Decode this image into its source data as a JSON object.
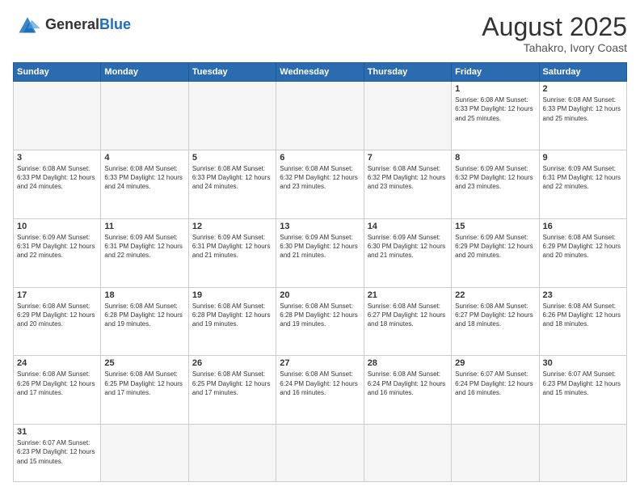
{
  "header": {
    "logo_general": "General",
    "logo_blue": "Blue",
    "month_title": "August 2025",
    "location": "Tahakro, Ivory Coast"
  },
  "weekdays": [
    "Sunday",
    "Monday",
    "Tuesday",
    "Wednesday",
    "Thursday",
    "Friday",
    "Saturday"
  ],
  "weeks": [
    [
      {
        "day": "",
        "info": ""
      },
      {
        "day": "",
        "info": ""
      },
      {
        "day": "",
        "info": ""
      },
      {
        "day": "",
        "info": ""
      },
      {
        "day": "",
        "info": ""
      },
      {
        "day": "1",
        "info": "Sunrise: 6:08 AM\nSunset: 6:33 PM\nDaylight: 12 hours\nand 25 minutes."
      },
      {
        "day": "2",
        "info": "Sunrise: 6:08 AM\nSunset: 6:33 PM\nDaylight: 12 hours\nand 25 minutes."
      }
    ],
    [
      {
        "day": "3",
        "info": "Sunrise: 6:08 AM\nSunset: 6:33 PM\nDaylight: 12 hours\nand 24 minutes."
      },
      {
        "day": "4",
        "info": "Sunrise: 6:08 AM\nSunset: 6:33 PM\nDaylight: 12 hours\nand 24 minutes."
      },
      {
        "day": "5",
        "info": "Sunrise: 6:08 AM\nSunset: 6:33 PM\nDaylight: 12 hours\nand 24 minutes."
      },
      {
        "day": "6",
        "info": "Sunrise: 6:08 AM\nSunset: 6:32 PM\nDaylight: 12 hours\nand 23 minutes."
      },
      {
        "day": "7",
        "info": "Sunrise: 6:08 AM\nSunset: 6:32 PM\nDaylight: 12 hours\nand 23 minutes."
      },
      {
        "day": "8",
        "info": "Sunrise: 6:09 AM\nSunset: 6:32 PM\nDaylight: 12 hours\nand 23 minutes."
      },
      {
        "day": "9",
        "info": "Sunrise: 6:09 AM\nSunset: 6:31 PM\nDaylight: 12 hours\nand 22 minutes."
      }
    ],
    [
      {
        "day": "10",
        "info": "Sunrise: 6:09 AM\nSunset: 6:31 PM\nDaylight: 12 hours\nand 22 minutes."
      },
      {
        "day": "11",
        "info": "Sunrise: 6:09 AM\nSunset: 6:31 PM\nDaylight: 12 hours\nand 22 minutes."
      },
      {
        "day": "12",
        "info": "Sunrise: 6:09 AM\nSunset: 6:31 PM\nDaylight: 12 hours\nand 21 minutes."
      },
      {
        "day": "13",
        "info": "Sunrise: 6:09 AM\nSunset: 6:30 PM\nDaylight: 12 hours\nand 21 minutes."
      },
      {
        "day": "14",
        "info": "Sunrise: 6:09 AM\nSunset: 6:30 PM\nDaylight: 12 hours\nand 21 minutes."
      },
      {
        "day": "15",
        "info": "Sunrise: 6:09 AM\nSunset: 6:29 PM\nDaylight: 12 hours\nand 20 minutes."
      },
      {
        "day": "16",
        "info": "Sunrise: 6:08 AM\nSunset: 6:29 PM\nDaylight: 12 hours\nand 20 minutes."
      }
    ],
    [
      {
        "day": "17",
        "info": "Sunrise: 6:08 AM\nSunset: 6:29 PM\nDaylight: 12 hours\nand 20 minutes."
      },
      {
        "day": "18",
        "info": "Sunrise: 6:08 AM\nSunset: 6:28 PM\nDaylight: 12 hours\nand 19 minutes."
      },
      {
        "day": "19",
        "info": "Sunrise: 6:08 AM\nSunset: 6:28 PM\nDaylight: 12 hours\nand 19 minutes."
      },
      {
        "day": "20",
        "info": "Sunrise: 6:08 AM\nSunset: 6:28 PM\nDaylight: 12 hours\nand 19 minutes."
      },
      {
        "day": "21",
        "info": "Sunrise: 6:08 AM\nSunset: 6:27 PM\nDaylight: 12 hours\nand 18 minutes."
      },
      {
        "day": "22",
        "info": "Sunrise: 6:08 AM\nSunset: 6:27 PM\nDaylight: 12 hours\nand 18 minutes."
      },
      {
        "day": "23",
        "info": "Sunrise: 6:08 AM\nSunset: 6:26 PM\nDaylight: 12 hours\nand 18 minutes."
      }
    ],
    [
      {
        "day": "24",
        "info": "Sunrise: 6:08 AM\nSunset: 6:26 PM\nDaylight: 12 hours\nand 17 minutes."
      },
      {
        "day": "25",
        "info": "Sunrise: 6:08 AM\nSunset: 6:25 PM\nDaylight: 12 hours\nand 17 minutes."
      },
      {
        "day": "26",
        "info": "Sunrise: 6:08 AM\nSunset: 6:25 PM\nDaylight: 12 hours\nand 17 minutes."
      },
      {
        "day": "27",
        "info": "Sunrise: 6:08 AM\nSunset: 6:24 PM\nDaylight: 12 hours\nand 16 minutes."
      },
      {
        "day": "28",
        "info": "Sunrise: 6:08 AM\nSunset: 6:24 PM\nDaylight: 12 hours\nand 16 minutes."
      },
      {
        "day": "29",
        "info": "Sunrise: 6:07 AM\nSunset: 6:24 PM\nDaylight: 12 hours\nand 16 minutes."
      },
      {
        "day": "30",
        "info": "Sunrise: 6:07 AM\nSunset: 6:23 PM\nDaylight: 12 hours\nand 15 minutes."
      }
    ],
    [
      {
        "day": "31",
        "info": "Sunrise: 6:07 AM\nSunset: 6:23 PM\nDaylight: 12 hours\nand 15 minutes."
      },
      {
        "day": "",
        "info": ""
      },
      {
        "day": "",
        "info": ""
      },
      {
        "day": "",
        "info": ""
      },
      {
        "day": "",
        "info": ""
      },
      {
        "day": "",
        "info": ""
      },
      {
        "day": "",
        "info": ""
      }
    ]
  ]
}
